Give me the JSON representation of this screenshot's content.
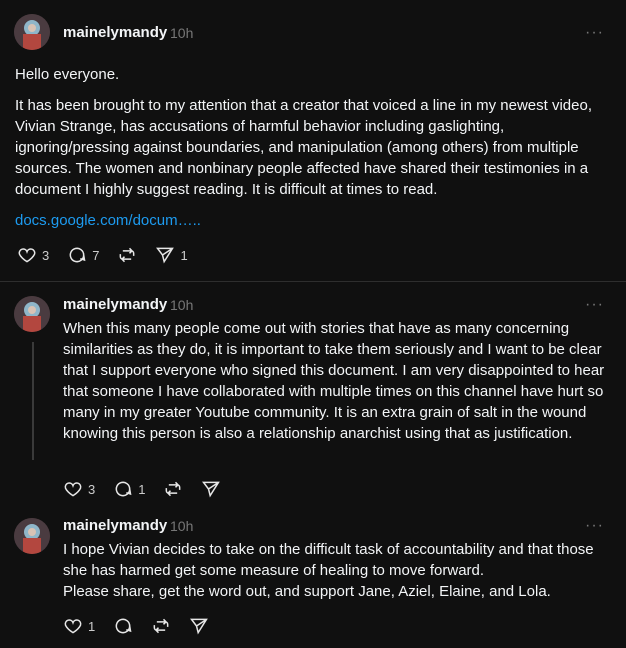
{
  "posts": [
    {
      "username": "mainelymandy",
      "time": "10h",
      "more": "···",
      "paragraphs": [
        "Hello everyone.",
        "It has been brought to my attention that a creator that voiced a line in my newest video, Vivian Strange, has accusations of harmful behavior including gaslighting, ignoring/pressing against boundaries, and manipulation (among others) from multiple sources. The women and nonbinary people affected have shared their testimonies in a document I highly suggest reading. It is difficult at times to read."
      ],
      "link": "docs.google.com/docum…..",
      "likes": "3",
      "replies": "7",
      "reposts": "",
      "shares": "1"
    },
    {
      "username": "mainelymandy",
      "time": "10h",
      "more": "···",
      "paragraphs": [
        "When this many people come out with stories that have as many concerning similarities as they do, it is important to take them seriously and I want to be clear that I support everyone who signed this document. I am very disappointed to hear that someone I have collaborated with multiple times on this channel have hurt so many in my greater Youtube community. It is an extra grain of salt in the wound knowing this person is also a relationship anarchist using that as justification."
      ],
      "likes": "3",
      "replies": "1",
      "reposts": "",
      "shares": ""
    },
    {
      "username": "mainelymandy",
      "time": "10h",
      "more": "···",
      "paragraphs": [
        "I hope Vivian decides to take on the difficult task of accountability and that those she has harmed get some measure of healing to move forward.",
        "Please share, get the word out, and support Jane, Aziel, Elaine, and Lola."
      ],
      "likes": "1",
      "replies": "",
      "reposts": "",
      "shares": ""
    }
  ]
}
